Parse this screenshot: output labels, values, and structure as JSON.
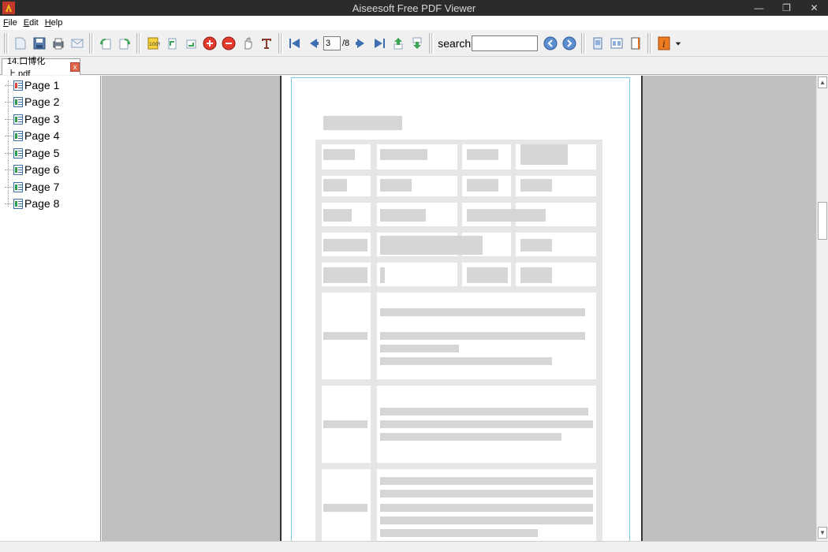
{
  "window": {
    "title": "Aiseesoft Free PDF Viewer",
    "controls": {
      "minimize": "—",
      "restore": "❐",
      "close": "✕"
    }
  },
  "menu": {
    "items": [
      {
        "label": "File",
        "accel": "F",
        "rest": "ile"
      },
      {
        "label": "Edit",
        "accel": "E",
        "rest": "dit"
      },
      {
        "label": "Help",
        "accel": "H",
        "rest": "elp"
      }
    ]
  },
  "toolbar": {
    "current_page": "3",
    "total_pages": "/8",
    "search_label": "search",
    "search_value": ""
  },
  "tabs": [
    {
      "label": "14.口博化上.pdf",
      "close": "x"
    }
  ],
  "sidebar": {
    "pages": [
      "Page 1",
      "Page 2",
      "Page 3",
      "Page 4",
      "Page 5",
      "Page 6",
      "Page 7",
      "Page 8"
    ]
  },
  "scrollbar": {
    "up": "▲",
    "down": "▼"
  },
  "colors": {
    "titlebar": "#2b2b2b",
    "viewer_bg": "#bfbfbf",
    "page_frame": "#7ec8ea"
  }
}
